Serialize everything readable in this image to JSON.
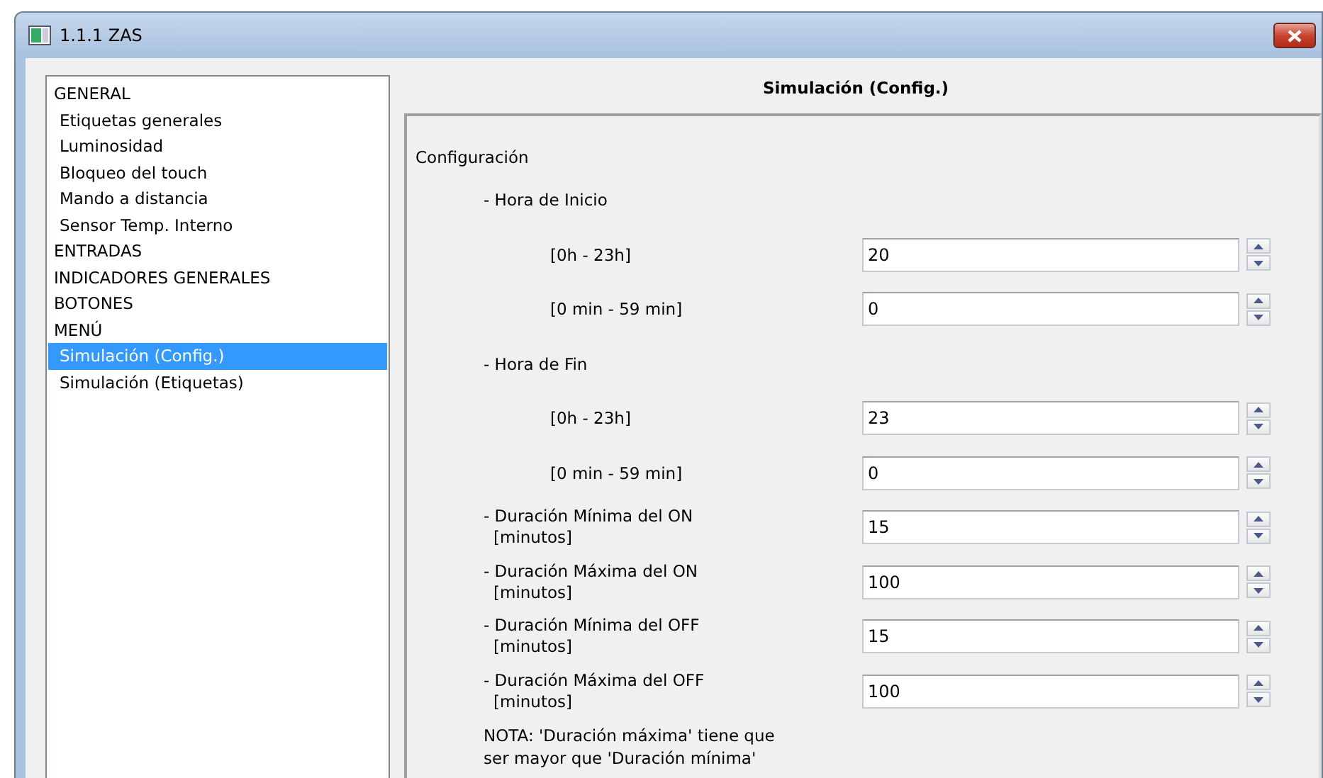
{
  "window": {
    "title": "1.1.1 ZAS"
  },
  "sidebar": {
    "items": [
      {
        "label": "GENERAL",
        "kind": "top",
        "selected": false
      },
      {
        "label": "Etiquetas generales",
        "kind": "sub",
        "selected": false
      },
      {
        "label": "Luminosidad",
        "kind": "sub",
        "selected": false
      },
      {
        "label": "Bloqueo del touch",
        "kind": "sub",
        "selected": false
      },
      {
        "label": "Mando a distancia",
        "kind": "sub",
        "selected": false
      },
      {
        "label": "Sensor Temp. Interno",
        "kind": "sub",
        "selected": false
      },
      {
        "label": "ENTRADAS",
        "kind": "top",
        "selected": false
      },
      {
        "label": "INDICADORES GENERALES",
        "kind": "top",
        "selected": false
      },
      {
        "label": "BOTONES",
        "kind": "top",
        "selected": false
      },
      {
        "label": "MENÚ",
        "kind": "top",
        "selected": false
      },
      {
        "label": "Simulación (Config.)",
        "kind": "sub",
        "selected": true
      },
      {
        "label": "Simulación (Etiquetas)",
        "kind": "sub",
        "selected": false
      }
    ]
  },
  "panel": {
    "title": "Simulación (Config.)",
    "rows": [
      {
        "kind": "section",
        "label": "Configuración"
      },
      {
        "kind": "group",
        "label": "- Hora de Inicio"
      },
      {
        "kind": "range",
        "label": "[0h - 23h]",
        "value": "20"
      },
      {
        "kind": "range",
        "label": "[0 min - 59 min]",
        "value": "0"
      },
      {
        "kind": "group",
        "label": "- Hora de Fin"
      },
      {
        "kind": "range",
        "label": "[0h - 23h]",
        "value": "23"
      },
      {
        "kind": "range",
        "label": "[0 min - 59 min]",
        "value": "0"
      },
      {
        "kind": "duration",
        "label": "- Duración Mínima del ON",
        "unit": "[minutos]",
        "value": "15"
      },
      {
        "kind": "duration",
        "label": "- Duración Máxima del ON",
        "unit": "[minutos]",
        "value": "100"
      },
      {
        "kind": "duration",
        "label": "- Duración Mínima del OFF",
        "unit": "[minutos]",
        "value": "15"
      },
      {
        "kind": "duration",
        "label": "- Duración Máxima del OFF",
        "unit": "[minutos]",
        "value": "100"
      },
      {
        "kind": "note",
        "lines": [
          "NOTA: 'Duración máxima' tiene que",
          "ser mayor que 'Duración mínima'"
        ]
      }
    ]
  }
}
